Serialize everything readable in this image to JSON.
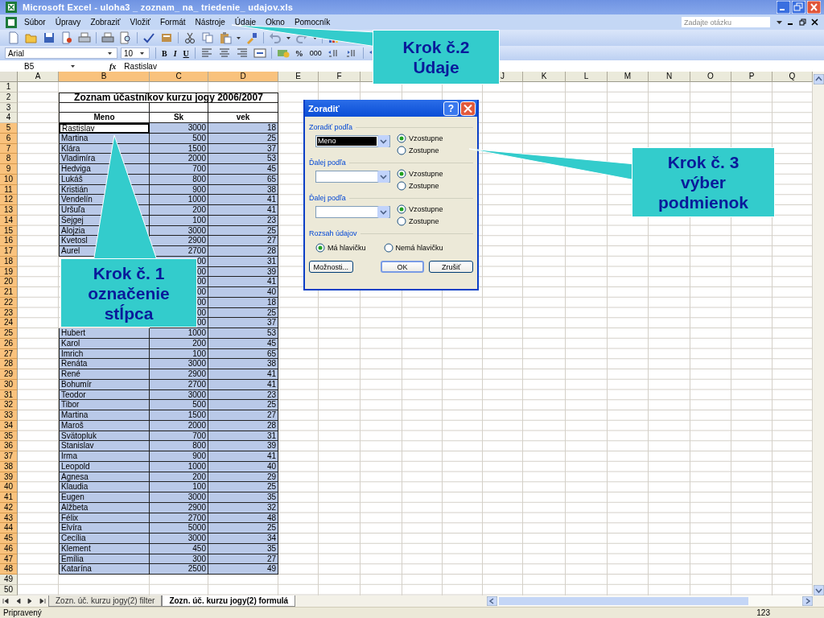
{
  "window": {
    "title": "Microsoft Excel - uloha3 _ zoznam_ na_ triedenie_ udajov.xls"
  },
  "menu": {
    "items": [
      "Súbor",
      "Úpravy",
      "Zobraziť",
      "Vložiť",
      "Formát",
      "Nástroje",
      "Údaje",
      "Okno",
      "Pomocník"
    ],
    "help_placeholder": "Zadajte otázku"
  },
  "format_toolbar": {
    "font": "Arial",
    "size": "10",
    "buttons": [
      "B",
      "I",
      "U",
      "%",
      "000"
    ]
  },
  "formula_bar": {
    "name_box": "B5",
    "fx": "fx",
    "value": "Rastislav"
  },
  "sheet": {
    "columns": [
      {
        "label": "A",
        "selected": false
      },
      {
        "label": "B",
        "selected": true
      },
      {
        "label": "C",
        "selected": true
      },
      {
        "label": "D",
        "selected": true
      },
      {
        "label": "E",
        "selected": false
      },
      {
        "label": "F",
        "selected": false
      },
      {
        "label": "J",
        "selected": false
      },
      {
        "label": "K",
        "selected": false
      },
      {
        "label": "L",
        "selected": false
      },
      {
        "label": "M",
        "selected": false
      },
      {
        "label": "N",
        "selected": false
      },
      {
        "label": "O",
        "selected": false
      },
      {
        "label": "P",
        "selected": false
      },
      {
        "label": "Q",
        "selected": false
      }
    ],
    "row_headers": [
      {
        "label": "1",
        "selected": false
      },
      {
        "label": "2",
        "selected": false
      },
      {
        "label": "3",
        "selected": false
      },
      {
        "label": "4",
        "selected": false
      },
      {
        "label": "5",
        "selected": true
      },
      {
        "label": "6",
        "selected": true
      },
      {
        "label": "7",
        "selected": true
      },
      {
        "label": "8",
        "selected": true
      },
      {
        "label": "9",
        "selected": true
      },
      {
        "label": "10",
        "selected": true
      },
      {
        "label": "11",
        "selected": true
      },
      {
        "label": "12",
        "selected": true
      },
      {
        "label": "13",
        "selected": true
      },
      {
        "label": "14",
        "selected": true
      },
      {
        "label": "15",
        "selected": true
      },
      {
        "label": "16",
        "selected": true
      },
      {
        "label": "17",
        "selected": true
      },
      {
        "label": "18",
        "selected": true
      },
      {
        "label": "19",
        "selected": true
      },
      {
        "label": "20",
        "selected": true
      },
      {
        "label": "21",
        "selected": true
      },
      {
        "label": "22",
        "selected": true
      },
      {
        "label": "23",
        "selected": true
      },
      {
        "label": "24",
        "selected": true
      },
      {
        "label": "25",
        "selected": true
      },
      {
        "label": "26",
        "selected": true
      },
      {
        "label": "27",
        "selected": true
      },
      {
        "label": "28",
        "selected": true
      },
      {
        "label": "29",
        "selected": true
      },
      {
        "label": "30",
        "selected": true
      },
      {
        "label": "31",
        "selected": true
      },
      {
        "label": "32",
        "selected": true
      },
      {
        "label": "33",
        "selected": true
      },
      {
        "label": "34",
        "selected": true
      },
      {
        "label": "35",
        "selected": true
      },
      {
        "label": "36",
        "selected": true
      },
      {
        "label": "37",
        "selected": true
      },
      {
        "label": "38",
        "selected": true
      },
      {
        "label": "39",
        "selected": true
      },
      {
        "label": "40",
        "selected": true
      },
      {
        "label": "41",
        "selected": true
      },
      {
        "label": "42",
        "selected": true
      },
      {
        "label": "43",
        "selected": true
      },
      {
        "label": "44",
        "selected": true
      },
      {
        "label": "45",
        "selected": true
      },
      {
        "label": "46",
        "selected": true
      },
      {
        "label": "47",
        "selected": true
      },
      {
        "label": "48",
        "selected": true
      },
      {
        "label": "49",
        "selected": false
      },
      {
        "label": "50",
        "selected": false
      }
    ],
    "title": "Zoznam účastníkov kurzu jogy 2006/2007",
    "headers": [
      "Meno",
      "Sk",
      "vek"
    ],
    "rows": [
      {
        "name": "Rastislav",
        "sk": "3000",
        "vek": "18",
        "active": true
      },
      {
        "name": "Martina",
        "sk": "500",
        "vek": "25",
        "active": false
      },
      {
        "name": "Klára",
        "sk": "1500",
        "vek": "37",
        "active": false
      },
      {
        "name": "Vladimíra",
        "sk": "2000",
        "vek": "53",
        "active": false
      },
      {
        "name": "Hedviga",
        "sk": "700",
        "vek": "45",
        "active": false
      },
      {
        "name": "Lukáš",
        "sk": "800",
        "vek": "65",
        "active": false
      },
      {
        "name": "Kristián",
        "sk": "900",
        "vek": "38",
        "active": false
      },
      {
        "name": "Vendelín",
        "sk": "1000",
        "vek": "41",
        "active": false
      },
      {
        "name": "Uršuľa",
        "sk": "200",
        "vek": "41",
        "active": false
      },
      {
        "name": "Sejgej",
        "sk": "100",
        "vek": "23",
        "active": false
      },
      {
        "name": "Alojzia",
        "sk": "3000",
        "vek": "25",
        "active": false
      },
      {
        "name": "Kvetosl",
        "sk": "2900",
        "vek": "27",
        "active": false
      },
      {
        "name": "Aurel",
        "sk": "2700",
        "vek": "28",
        "active": false
      },
      {
        "sk": "00",
        "vek": "31",
        "active": false
      },
      {
        "sk": "00",
        "vek": "39",
        "active": false
      },
      {
        "sk": "00",
        "vek": "41",
        "active": false
      },
      {
        "sk": "00",
        "vek": "40",
        "active": false
      },
      {
        "sk": "00",
        "vek": "18",
        "active": false
      },
      {
        "sk": "00",
        "vek": "25",
        "active": false
      },
      {
        "sk": "00",
        "vek": "37",
        "active": false
      },
      {
        "name": "Hubert",
        "sk": "1000",
        "vek": "53",
        "active": false
      },
      {
        "name": "Karol",
        "sk": "200",
        "vek": "45",
        "active": false
      },
      {
        "name": "Imrich",
        "sk": "100",
        "vek": "65",
        "active": false
      },
      {
        "name": "Renáta",
        "sk": "3000",
        "vek": "38",
        "active": false
      },
      {
        "name": "René",
        "sk": "2900",
        "vek": "41",
        "active": false
      },
      {
        "name": "Bohumír",
        "sk": "2700",
        "vek": "41",
        "active": false
      },
      {
        "name": "Teodor",
        "sk": "3000",
        "vek": "23",
        "active": false
      },
      {
        "name": "Tibor",
        "sk": "500",
        "vek": "25",
        "active": false
      },
      {
        "name": "Martina",
        "sk": "1500",
        "vek": "27",
        "active": false
      },
      {
        "name": "Maroš",
        "sk": "2000",
        "vek": "28",
        "active": false
      },
      {
        "name": "Svätopluk",
        "sk": "700",
        "vek": "31",
        "active": false
      },
      {
        "name": "Stanislav",
        "sk": "800",
        "vek": "39",
        "active": false
      },
      {
        "name": "Irma",
        "sk": "900",
        "vek": "41",
        "active": false
      },
      {
        "name": "Leopold",
        "sk": "1000",
        "vek": "40",
        "active": false
      },
      {
        "name": "Agnesa",
        "sk": "200",
        "vek": "29",
        "active": false
      },
      {
        "name": "Klaudia",
        "sk": "100",
        "vek": "25",
        "active": false
      },
      {
        "name": "Eugen",
        "sk": "3000",
        "vek": "35",
        "active": false
      },
      {
        "name": "Alžbeta",
        "sk": "2900",
        "vek": "32",
        "active": false
      },
      {
        "name": "Félix",
        "sk": "2700",
        "vek": "48",
        "active": false
      },
      {
        "name": "Elvíra",
        "sk": "5000",
        "vek": "25",
        "active": false
      },
      {
        "name": "Cecília",
        "sk": "3000",
        "vek": "34",
        "active": false
      },
      {
        "name": "Klement",
        "sk": "450",
        "vek": "35",
        "active": false
      },
      {
        "name": "Emília",
        "sk": "300",
        "vek": "27",
        "active": false
      },
      {
        "name": "Katarína",
        "sk": "2500",
        "vek": "49",
        "active": false
      }
    ]
  },
  "dialog": {
    "title": "Zoradiť",
    "help": "?",
    "sections": [
      {
        "label": "Zoradiť podľa",
        "value": "Meno",
        "options": [
          {
            "label": "Vzostupne",
            "selected": true
          },
          {
            "label": "Zostupne",
            "selected": false
          }
        ]
      },
      {
        "label": "Ďalej podľa",
        "options": [
          {
            "label": "Vzostupne",
            "selected": true
          },
          {
            "label": "Zostupne",
            "selected": false
          }
        ]
      },
      {
        "label": "Ďalej podľa",
        "options": [
          {
            "label": "Vzostupne",
            "selected": true
          },
          {
            "label": "Zostupne",
            "selected": false
          }
        ]
      }
    ],
    "range": {
      "label": "Rozsah údajov",
      "options": [
        {
          "label": "Má hlavičku",
          "selected": true
        },
        {
          "label": "Nemá hlavičku",
          "selected": false
        }
      ]
    },
    "buttons": [
      "Možnosti...",
      "OK",
      "Zrušiť"
    ]
  },
  "sheet_tabs": [
    {
      "label": "Zozn. úč. kurzu jogy(2) filter",
      "selected": false
    },
    {
      "label": "Zozn. úč. kurzu jogy(2) formulá",
      "selected": true
    }
  ],
  "status_bar": {
    "text": "Pripravený",
    "indicator": "123"
  },
  "callouts": [
    {
      "lines": [
        "Krok č.2",
        "Údaje"
      ]
    },
    {
      "lines": [
        "Krok č. 3",
        "výber",
        "podmienok"
      ]
    },
    {
      "lines": [
        "Krok č. 1",
        "označenie",
        "stĺpca"
      ]
    }
  ]
}
